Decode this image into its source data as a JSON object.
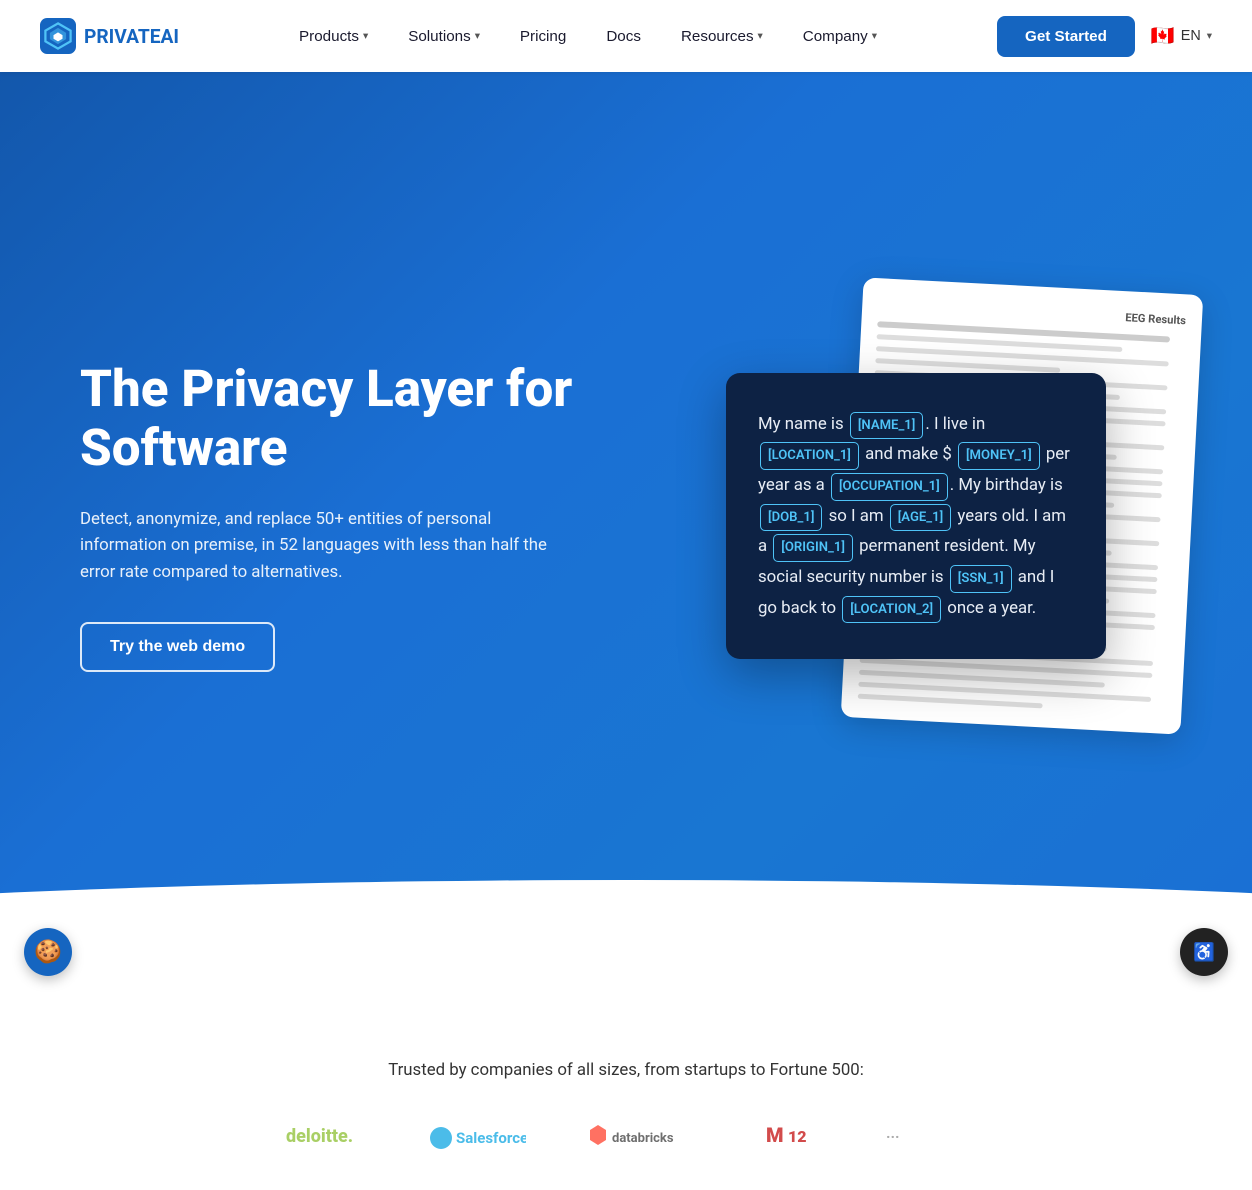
{
  "nav": {
    "logo_text": "PRIVATEAI",
    "links": [
      {
        "label": "Products",
        "has_dropdown": true
      },
      {
        "label": "Solutions",
        "has_dropdown": true
      },
      {
        "label": "Pricing",
        "has_dropdown": false
      },
      {
        "label": "Docs",
        "has_dropdown": false
      },
      {
        "label": "Resources",
        "has_dropdown": true
      },
      {
        "label": "Company",
        "has_dropdown": true
      }
    ],
    "get_started_label": "Get Started",
    "lang": "EN"
  },
  "hero": {
    "heading": "The Privacy Layer for Software",
    "description": "Detect, anonymize, and replace 50+ entities of personal information on premise, in 52 languages with less than half the error rate compared to alternatives.",
    "cta_label": "Try the web demo",
    "demo_card": {
      "text_parts": [
        {
          "type": "text",
          "content": "My name is "
        },
        {
          "type": "tag",
          "content": "[NAME_1]"
        },
        {
          "type": "text",
          "content": ". I live in "
        },
        {
          "type": "tag",
          "content": "[LOCATION_1]"
        },
        {
          "type": "text",
          "content": " and make $ "
        },
        {
          "type": "tag",
          "content": "[MONEY_1]"
        },
        {
          "type": "text",
          "content": " per year as a "
        },
        {
          "type": "tag",
          "content": "[OCCUPATION_1]"
        },
        {
          "type": "text",
          "content": ". My birthday is "
        },
        {
          "type": "tag",
          "content": "[DOB_1]"
        },
        {
          "type": "text",
          "content": " so I am "
        },
        {
          "type": "tag",
          "content": "[AGE_1]"
        },
        {
          "type": "text",
          "content": " years old. I am a "
        },
        {
          "type": "tag",
          "content": "[ORIGIN_1]"
        },
        {
          "type": "text",
          "content": " permanent resident. My social security number is "
        },
        {
          "type": "tag",
          "content": "[SSN_1]"
        },
        {
          "type": "text",
          "content": " and I go back to "
        },
        {
          "type": "tag",
          "content": "[LOCATION_2]"
        },
        {
          "type": "text",
          "content": " once a year."
        }
      ]
    }
  },
  "trusted": {
    "heading": "Trusted by companies of all sizes, from startups to Fortune 500:"
  }
}
